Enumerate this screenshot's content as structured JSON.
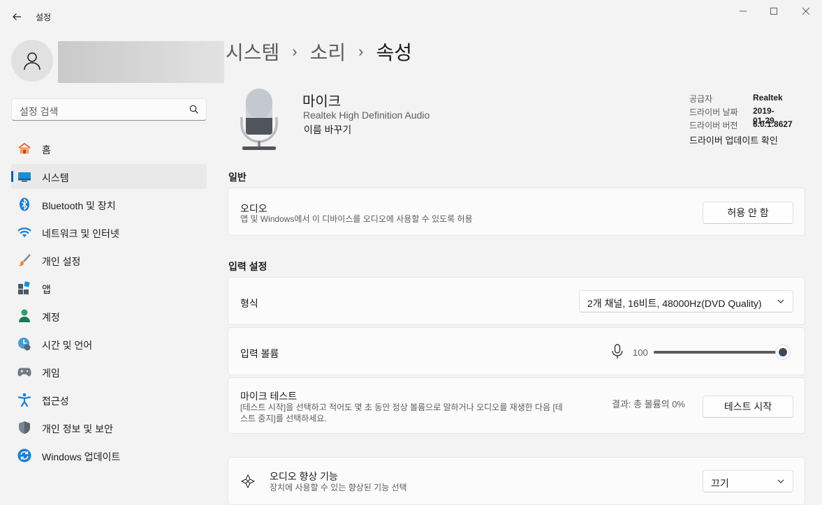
{
  "window": {
    "title": "설정",
    "minimize_icon": "minimize-icon",
    "maximize_icon": "maximize-icon",
    "close_icon": "close-icon"
  },
  "sidebar": {
    "search_placeholder": "설정 검색",
    "items": [
      {
        "label": "홈",
        "icon": "home-icon"
      },
      {
        "label": "시스템",
        "icon": "system-icon",
        "active": true
      },
      {
        "label": "Bluetooth 및 장치",
        "icon": "bluetooth-icon"
      },
      {
        "label": "네트워크 및 인터넷",
        "icon": "wifi-icon"
      },
      {
        "label": "개인 설정",
        "icon": "brush-icon"
      },
      {
        "label": "앱",
        "icon": "apps-icon"
      },
      {
        "label": "계정",
        "icon": "account-icon"
      },
      {
        "label": "시간 및 언어",
        "icon": "time-language-icon"
      },
      {
        "label": "게임",
        "icon": "gamepad-icon"
      },
      {
        "label": "접근성",
        "icon": "accessibility-icon"
      },
      {
        "label": "개인 정보 및 보안",
        "icon": "shield-icon"
      },
      {
        "label": "Windows 업데이트",
        "icon": "update-icon"
      }
    ]
  },
  "breadcrumb": [
    "시스템",
    "소리",
    "속성"
  ],
  "device": {
    "name": "마이크",
    "description": "Realtek High Definition Audio",
    "rename": "이름 바꾸기",
    "properties": [
      {
        "label": "공급자",
        "value": "Realtek"
      },
      {
        "label": "드라이버 날짜",
        "value": "2019-01-29"
      },
      {
        "label": "드라이버 버전",
        "value": "6.0.1.8627"
      }
    ],
    "driver_update": "드라이버 업데이트 확인"
  },
  "general": {
    "title": "일반",
    "audio": {
      "title": "오디오",
      "subtitle": "앱 및 Windows에서 이 디바이스를 오디오에 사용할 수 있도록 허용",
      "button": "허용 안 함"
    }
  },
  "input_settings": {
    "title": "입력 설정",
    "format": {
      "label": "형식",
      "value": "2개 채널, 16비트, 48000Hz(DVD Quality)"
    },
    "volume": {
      "label": "입력 볼륨",
      "value": "100",
      "level": 1.0
    },
    "mic_test": {
      "title": "마이크 테스트",
      "subtitle_line1": "[테스트 시작]을 선택하고 적어도 몇 초 동안 정상 볼륨으로 말하거나 오디오를 재생한 다음 [테",
      "subtitle_line2": "스트 중지]를 선택하세요.",
      "result": "결과: 총 볼륨의 0%",
      "button": "테스트 시작"
    }
  },
  "enhancements": {
    "title": "오디오 향상 기능",
    "subtitle": "장치에 사용할 수 있는 향상된 기능 선택",
    "value": "끄기"
  }
}
